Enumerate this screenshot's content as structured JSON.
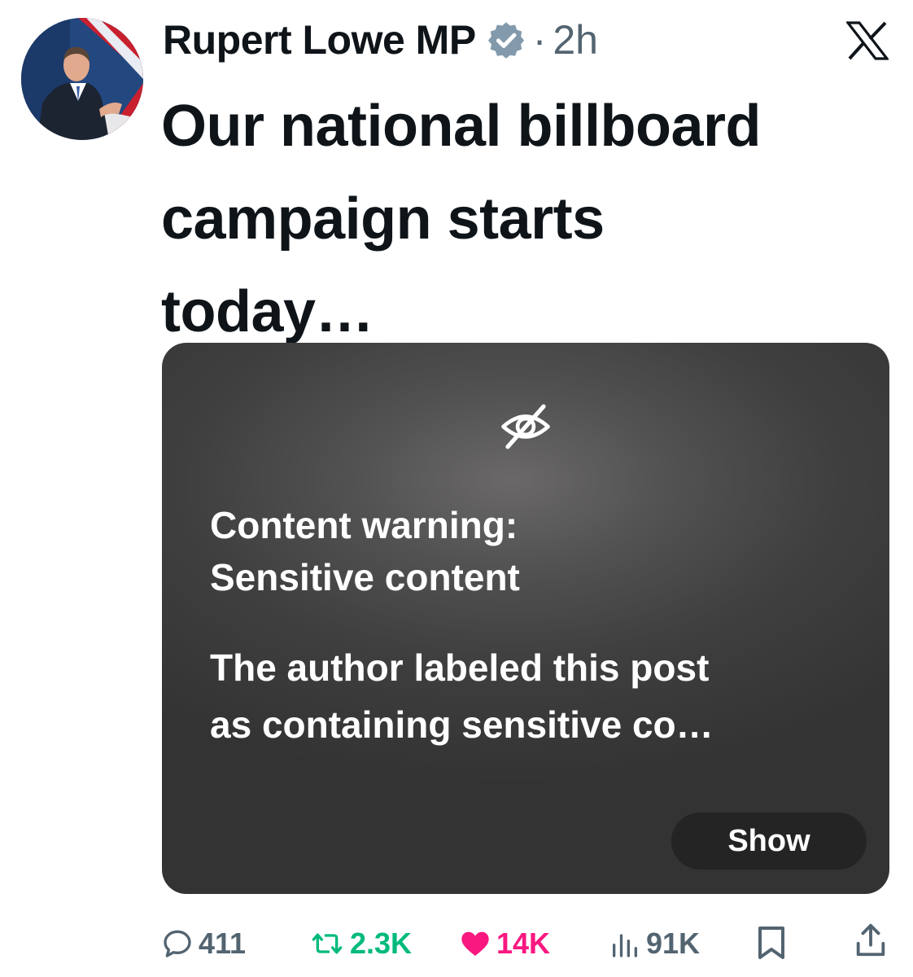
{
  "post": {
    "author_name": "Rupert Lowe MP",
    "separator": "·",
    "time": "2h",
    "text_lines": [
      "Our national billboard",
      "campaign starts",
      "today…"
    ]
  },
  "media": {
    "warning_title_lines": [
      "Content warning:",
      "Sensitive content"
    ],
    "warning_desc_lines": [
      "The author labeled this post",
      "as containing sensitive co…"
    ],
    "show_label": "Show"
  },
  "actions": {
    "replies": "411",
    "reposts": "2.3K",
    "likes": "14K",
    "views": "91K"
  },
  "colors": {
    "text": "#0f1419",
    "secondary": "#536471",
    "repost_active": "#00ba7c",
    "like_active": "#f91880",
    "overlay_bg": "#3f3f3f"
  },
  "icons": [
    "avatar",
    "verified-badge-icon",
    "x-logo-icon",
    "eye-slash-icon",
    "reply-icon",
    "retweet-icon",
    "heart-icon",
    "views-icon",
    "bookmark-icon",
    "share-icon"
  ]
}
